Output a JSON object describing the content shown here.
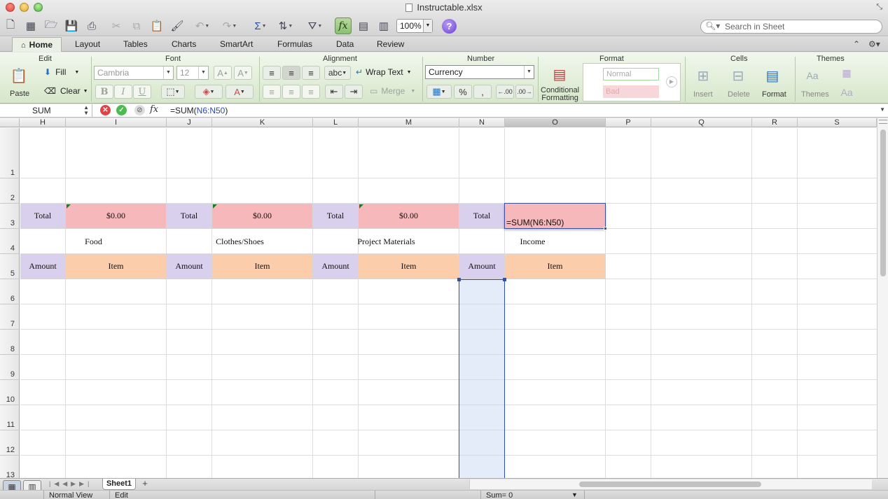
{
  "window": {
    "title": "Instructable.xlsx"
  },
  "toolbar": {
    "zoom": "100%",
    "search_placeholder": "Search in Sheet"
  },
  "ribbon": {
    "tabs": [
      {
        "label": "Home",
        "active": true
      },
      {
        "label": "Layout"
      },
      {
        "label": "Tables"
      },
      {
        "label": "Charts"
      },
      {
        "label": "SmartArt"
      },
      {
        "label": "Formulas"
      },
      {
        "label": "Data"
      },
      {
        "label": "Review"
      }
    ],
    "groups": {
      "edit": "Edit",
      "font": "Font",
      "alignment": "Alignment",
      "number": "Number",
      "format": "Format",
      "cells": "Cells",
      "themes": "Themes"
    },
    "edit": {
      "paste": "Paste",
      "fill": "Fill",
      "clear": "Clear"
    },
    "font": {
      "family": "Cambria",
      "size": "12",
      "bold": "B",
      "italic": "I",
      "underline": "U"
    },
    "alignment": {
      "wrap_text": "Wrap Text",
      "merge": "Merge",
      "orientation": "abc"
    },
    "number": {
      "format": "Currency"
    },
    "format": {
      "conditional_1": "Conditional",
      "conditional_2": "Formatting",
      "style_normal": "Normal",
      "style_bad": "Bad"
    },
    "cells": {
      "insert": "Insert",
      "delete": "Delete",
      "format": "Format"
    },
    "themes": {
      "themes": "Themes"
    }
  },
  "formula_bar": {
    "name_box": "SUM",
    "formula_prefix": "=SUM(",
    "formula_ref": "N6:N50",
    "formula_suffix": ")"
  },
  "grid": {
    "columns": [
      "H",
      "I",
      "J",
      "K",
      "L",
      "M",
      "N",
      "O",
      "P",
      "Q",
      "R",
      "S"
    ],
    "rows": [
      "1",
      "2",
      "3",
      "4",
      "5",
      "6",
      "7",
      "8",
      "9",
      "10",
      "11",
      "12",
      "13"
    ],
    "selected_column": "O",
    "totals": [
      {
        "label": "Total",
        "value": "$0.00"
      },
      {
        "label": "Total",
        "value": "$0.00"
      },
      {
        "label": "Total",
        "value": "$0.00"
      },
      {
        "label": "Total"
      }
    ],
    "categories": [
      "Food",
      "Clothes/Shoes",
      "Project Materials",
      "Income"
    ],
    "amount_header": "Amount",
    "item_header": "Item",
    "editing_cell": "=SUM(N6:N50)"
  },
  "sheets": [
    {
      "name": "Sheet1"
    }
  ],
  "status": {
    "view": "Normal View",
    "mode": "Edit",
    "sum": "Sum= 0"
  },
  "colors": {
    "purple": "#d8d0ec",
    "pink": "#f6b8bb",
    "peach": "#fccdab",
    "ribbon": "#e2eed9"
  }
}
